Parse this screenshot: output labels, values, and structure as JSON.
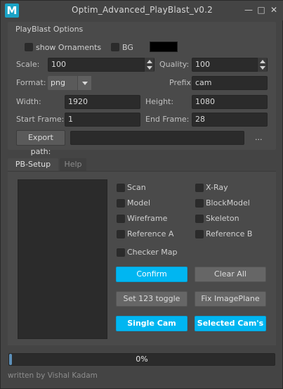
{
  "window": {
    "title": "Optim_Advanced_PlayBlast_v0.2",
    "icon_letter": "M",
    "controls": {
      "minimize": "—",
      "maximize": "□",
      "close": "✕"
    }
  },
  "options": {
    "group_title": "PlayBlast Options",
    "show_ornaments": {
      "label": "show Ornaments",
      "checked": false
    },
    "bg": {
      "label": "BG",
      "checked": false,
      "color": "#000000"
    },
    "scale": {
      "label": "Scale:",
      "value": "100"
    },
    "quality": {
      "label": "Quality:",
      "value": "100"
    },
    "format": {
      "label": "Format:",
      "value": "png"
    },
    "prefix": {
      "label": "Prefix:",
      "value": "cam"
    },
    "width": {
      "label": "Width:",
      "value": "1920"
    },
    "height": {
      "label": "Height:",
      "value": "1080"
    },
    "start_frame": {
      "label": "Start Frame:",
      "value": "1"
    },
    "end_frame": {
      "label": "End Frame:",
      "value": "28"
    },
    "export_path": {
      "button_label": "Export path:",
      "value": "",
      "browse_label": "..."
    }
  },
  "tabs": [
    {
      "label": "PB-Setup",
      "active": true
    },
    {
      "label": "Help",
      "active": false
    }
  ],
  "pb_setup": {
    "checkboxes_left": [
      {
        "label": "Scan",
        "checked": false
      },
      {
        "label": "Model",
        "checked": false
      },
      {
        "label": "Wireframe",
        "checked": false
      },
      {
        "label": "Reference A",
        "checked": false
      },
      {
        "label": "Checker Map",
        "checked": false
      }
    ],
    "checkboxes_right": [
      {
        "label": "X-Ray",
        "checked": false
      },
      {
        "label": "BlockModel",
        "checked": false
      },
      {
        "label": "Skeleton",
        "checked": false
      },
      {
        "label": "Reference B",
        "checked": false
      }
    ],
    "buttons": {
      "confirm": "Confirm",
      "clear_all": "Clear All",
      "set_123_toggle": "Set 123 toggle",
      "fix_imageplane": "Fix ImagePlane",
      "single_cam": "Single Cam",
      "selected_cams": "Selected Cam's"
    }
  },
  "progress": {
    "value": 0.0,
    "text": "0%"
  },
  "footer": "written by Vishal Kadam",
  "colors": {
    "accent": "#00b6f1",
    "background": "#444444",
    "field": "#2b2b2b"
  }
}
